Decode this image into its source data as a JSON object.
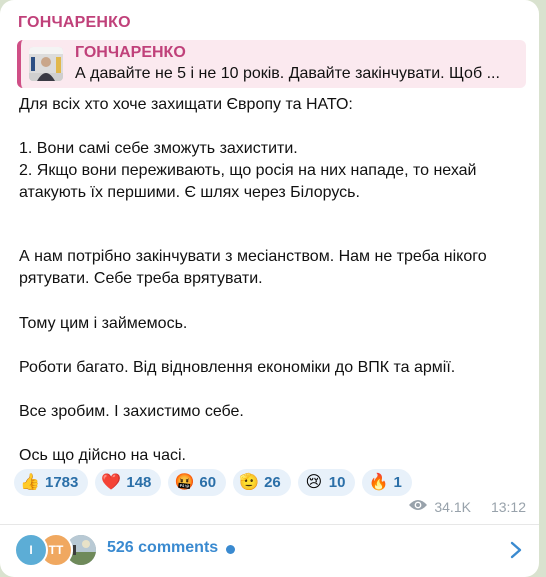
{
  "channel": {
    "name": "ГОНЧАРЕНКО"
  },
  "reply": {
    "name": "ГОНЧАРЕНКО",
    "text": "А давайте не 5 і не 10 років. Давайте закінчувати. Щоб ..."
  },
  "message": {
    "lines": [
      "Для всіх хто хоче захищати Європу та НАТО:",
      "1. Вони самі себе зможуть захистити.",
      "2. Якщо вони переживають, що росія на них нападе, то нехай атакують їх першими. Є шлях через Білорусь.",
      "А нам потрібно закінчувати з месіанством. Нам не треба нікого рятувати. Себе треба врятувати.",
      "Тому цим і займемось.",
      "Роботи багато. Від відновлення економіки до ВПК та армії.",
      "Все зробим. І захистимо себе.",
      "Ось що дійсно на часі."
    ]
  },
  "reactions": [
    {
      "emoji": "👍",
      "icon": "thumbs-up-icon",
      "count": "1783"
    },
    {
      "emoji": "❤️",
      "icon": "heart-icon",
      "count": "148"
    },
    {
      "emoji": "🤬",
      "icon": "angry-face-icon",
      "count": "60"
    },
    {
      "emoji": "🫡",
      "icon": "salute-icon",
      "count": "26"
    },
    {
      "emoji": "😢",
      "icon": "crying-face-icon",
      "count": "10"
    },
    {
      "emoji": "🔥",
      "icon": "fire-icon",
      "count": "1"
    }
  ],
  "meta": {
    "views": "34.1K",
    "time": "13:12"
  },
  "comments": {
    "label": "526 comments",
    "avatars": [
      {
        "initial": "І",
        "color": "#5cadd6"
      },
      {
        "initial": "ТТ",
        "color": "#f0a860"
      }
    ]
  },
  "colors": {
    "accent": "#c0417a",
    "link": "#3a8ad0",
    "reaction_bg": "#e8f1fa"
  }
}
